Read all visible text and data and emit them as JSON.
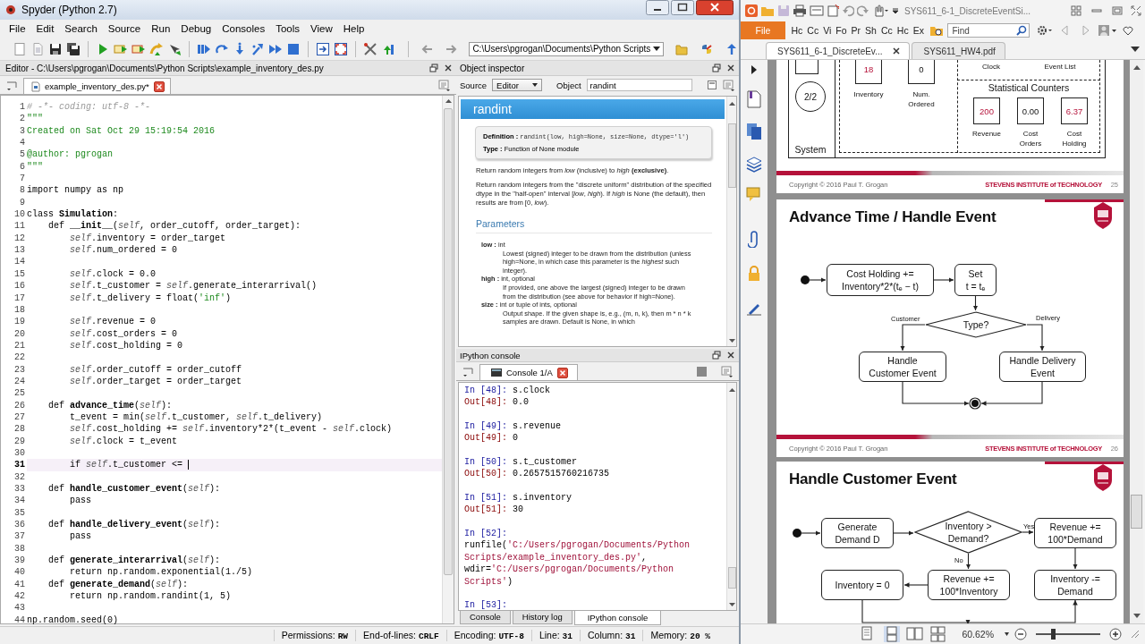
{
  "spyder": {
    "title": "Spyder (Python 2.7)",
    "menu": [
      "File",
      "Edit",
      "Search",
      "Source",
      "Run",
      "Debug",
      "Consoles",
      "Tools",
      "View",
      "Help"
    ],
    "path": "C:\\Users\\pgrogan\\Documents\\Python Scripts",
    "editor": {
      "header": "Editor - C:\\Users\\pgrogan\\Documents\\Python Scripts\\example_inventory_des.py",
      "tabs": [
        {
          "label": "example_inventory_des.py*",
          "selected": true
        }
      ],
      "lines": [
        {
          "number": "1",
          "current": false,
          "segments": [
            {
              "kind": "comment",
              "text": "# -*- coding: utf-8 -*-"
            }
          ]
        },
        {
          "number": "2",
          "current": false,
          "segments": [
            {
              "kind": "string",
              "text": "\"\"\""
            }
          ]
        },
        {
          "number": "3",
          "current": false,
          "segments": [
            {
              "kind": "string",
              "text": "Created on Sat Oct 29 15:19:54 2016"
            }
          ]
        },
        {
          "number": "4",
          "current": false
        },
        {
          "number": "5",
          "current": false,
          "segments": [
            {
              "kind": "string",
              "text": "@author: pgrogan"
            }
          ]
        },
        {
          "number": "6",
          "current": false,
          "segments": [
            {
              "kind": "string",
              "text": "\"\"\""
            }
          ]
        },
        {
          "number": "7",
          "current": false
        },
        {
          "number": "8",
          "current": false,
          "segments": [
            {
              "kind": "plain",
              "text": "import numpy as np"
            }
          ]
        },
        {
          "number": "9",
          "current": false
        },
        {
          "number": "10",
          "current": false,
          "segments": [
            {
              "kind": "plain",
              "text": "class "
            },
            {
              "kind": "name",
              "text": "Simulation"
            },
            {
              "kind": "plain",
              "text": ":"
            }
          ]
        },
        {
          "number": "11",
          "current": false,
          "segments": [
            {
              "kind": "plain",
              "text": "    def "
            },
            {
              "kind": "name",
              "text": "__init__"
            },
            {
              "kind": "plain",
              "text": "("
            },
            {
              "kind": "self",
              "text": "self"
            },
            {
              "kind": "plain",
              "text": ", order_cutoff, order_target):"
            }
          ]
        },
        {
          "number": "12",
          "current": false,
          "segments": [
            {
              "kind": "self",
              "text": "        self"
            },
            {
              "kind": "plain",
              "text": ".inventory = order_target"
            }
          ]
        },
        {
          "number": "13",
          "current": false,
          "segments": [
            {
              "kind": "self",
              "text": "        self"
            },
            {
              "kind": "plain",
              "text": ".num_ordered = 0"
            }
          ]
        },
        {
          "number": "14",
          "current": false
        },
        {
          "number": "15",
          "current": false,
          "segments": [
            {
              "kind": "self",
              "text": "        self"
            },
            {
              "kind": "plain",
              "text": ".clock = 0.0"
            }
          ]
        },
        {
          "number": "16",
          "current": false,
          "segments": [
            {
              "kind": "self",
              "text": "        self"
            },
            {
              "kind": "plain",
              "text": ".t_customer = "
            },
            {
              "kind": "self",
              "text": "self"
            },
            {
              "kind": "plain",
              "text": ".generate_interarrival()"
            }
          ]
        },
        {
          "number": "17",
          "current": false,
          "segments": [
            {
              "kind": "self",
              "text": "        self"
            },
            {
              "kind": "plain",
              "text": ".t_delivery = float("
            },
            {
              "kind": "string",
              "text": "'inf'"
            },
            {
              "kind": "plain",
              "text": ")"
            }
          ]
        },
        {
          "number": "18",
          "current": false
        },
        {
          "number": "19",
          "current": false,
          "segments": [
            {
              "kind": "self",
              "text": "        self"
            },
            {
              "kind": "plain",
              "text": ".revenue = 0"
            }
          ]
        },
        {
          "number": "20",
          "current": false,
          "segments": [
            {
              "kind": "self",
              "text": "        self"
            },
            {
              "kind": "plain",
              "text": ".cost_orders = 0"
            }
          ]
        },
        {
          "number": "21",
          "current": false,
          "segments": [
            {
              "kind": "self",
              "text": "        self"
            },
            {
              "kind": "plain",
              "text": ".cost_holding = 0"
            }
          ]
        },
        {
          "number": "22",
          "current": false
        },
        {
          "number": "23",
          "current": false,
          "segments": [
            {
              "kind": "self",
              "text": "        self"
            },
            {
              "kind": "plain",
              "text": ".order_cutoff = order_cutoff"
            }
          ]
        },
        {
          "number": "24",
          "current": false,
          "segments": [
            {
              "kind": "self",
              "text": "        self"
            },
            {
              "kind": "plain",
              "text": ".order_target = order_target"
            }
          ]
        },
        {
          "number": "25",
          "current": false
        },
        {
          "number": "26",
          "current": false,
          "segments": [
            {
              "kind": "plain",
              "text": "    def "
            },
            {
              "kind": "name",
              "text": "advance_time"
            },
            {
              "kind": "plain",
              "text": "("
            },
            {
              "kind": "self",
              "text": "self"
            },
            {
              "kind": "plain",
              "text": "):"
            }
          ]
        },
        {
          "number": "27",
          "current": false,
          "segments": [
            {
              "kind": "plain",
              "text": "        t_event = min("
            },
            {
              "kind": "self",
              "text": "self"
            },
            {
              "kind": "plain",
              "text": ".t_customer, "
            },
            {
              "kind": "self",
              "text": "self"
            },
            {
              "kind": "plain",
              "text": ".t_delivery)"
            }
          ]
        },
        {
          "number": "28",
          "current": false,
          "segments": [
            {
              "kind": "self",
              "text": "        self"
            },
            {
              "kind": "plain",
              "text": ".cost_holding += "
            },
            {
              "kind": "self",
              "text": "self"
            },
            {
              "kind": "plain",
              "text": ".inventory*2*(t_event - "
            },
            {
              "kind": "self",
              "text": "self"
            },
            {
              "kind": "plain",
              "text": ".clock)"
            }
          ]
        },
        {
          "number": "29",
          "current": false,
          "segments": [
            {
              "kind": "self",
              "text": "        self"
            },
            {
              "kind": "plain",
              "text": ".clock = t_event"
            }
          ]
        },
        {
          "number": "30",
          "current": false
        },
        {
          "number": "31",
          "current": true,
          "segments": [
            {
              "kind": "plain",
              "text": "        if "
            },
            {
              "kind": "self",
              "text": "self"
            },
            {
              "kind": "plain",
              "text": ".t_customer <= "
            }
          ]
        },
        {
          "number": "32",
          "current": false
        },
        {
          "number": "33",
          "current": false,
          "segments": [
            {
              "kind": "plain",
              "text": "    def "
            },
            {
              "kind": "name",
              "text": "handle_customer_event"
            },
            {
              "kind": "plain",
              "text": "("
            },
            {
              "kind": "self",
              "text": "self"
            },
            {
              "kind": "plain",
              "text": "):"
            }
          ]
        },
        {
          "number": "34",
          "current": false,
          "segments": [
            {
              "kind": "plain",
              "text": "        pass"
            }
          ]
        },
        {
          "number": "35",
          "current": false
        },
        {
          "number": "36",
          "current": false,
          "segments": [
            {
              "kind": "plain",
              "text": "    def "
            },
            {
              "kind": "name",
              "text": "handle_delivery_event"
            },
            {
              "kind": "plain",
              "text": "("
            },
            {
              "kind": "self",
              "text": "self"
            },
            {
              "kind": "plain",
              "text": "):"
            }
          ]
        },
        {
          "number": "37",
          "current": false,
          "segments": [
            {
              "kind": "plain",
              "text": "        pass"
            }
          ]
        },
        {
          "number": "38",
          "current": false
        },
        {
          "number": "39",
          "current": false,
          "segments": [
            {
              "kind": "plain",
              "text": "    def "
            },
            {
              "kind": "name",
              "text": "generate_interarrival"
            },
            {
              "kind": "plain",
              "text": "("
            },
            {
              "kind": "self",
              "text": "self"
            },
            {
              "kind": "plain",
              "text": "):"
            }
          ]
        },
        {
          "number": "40",
          "current": false,
          "segments": [
            {
              "kind": "plain",
              "text": "        return np.random.exponential(1./5)"
            }
          ]
        },
        {
          "number": "41",
          "current": false,
          "segments": [
            {
              "kind": "plain",
              "text": "    def "
            },
            {
              "kind": "name",
              "text": "generate_demand"
            },
            {
              "kind": "plain",
              "text": "("
            },
            {
              "kind": "self",
              "text": "self"
            },
            {
              "kind": "plain",
              "text": "):"
            }
          ]
        },
        {
          "number": "42",
          "current": false,
          "segments": [
            {
              "kind": "plain",
              "text": "        return np.random.randint(1, 5)"
            }
          ]
        },
        {
          "number": "43",
          "current": false
        },
        {
          "number": "44",
          "current": false,
          "segments": [
            {
              "kind": "plain",
              "text": "np.random.seed(0)"
            }
          ]
        }
      ]
    },
    "inspector": {
      "header": "Object inspector",
      "source_label": "Source",
      "source": "Editor",
      "object_label": "Object",
      "object": "randint",
      "title": "randint",
      "definition_label": "Definition :",
      "definition": "randint(low, high=None, size=None, dtype='l')",
      "type_label": "Type :",
      "type": "Function of None module",
      "paragraphs": [
        "Return random integers from *low* (inclusive) to *high* **(exclusive)**.",
        "Return random integers from the \"discrete uniform\" distribution of the specified dtype in the \"half-open\" interval [*low*, *high*). If *high* is None (the default), then results are from [0, *low*)."
      ],
      "section": "Parameters",
      "params": [
        {
          "name": "low :",
          "type": "int",
          "description": "Lowest (signed) integer to be drawn from the distribution (unless high=None, in which case this parameter is the *highest* such integer)."
        },
        {
          "name": "high :",
          "type": "int, optional",
          "description": "If provided, one above the largest (signed) integer to be drawn from the distribution (see above for behavior if high=None)."
        },
        {
          "name": "size :",
          "type": "int or tuple of ints, optional",
          "description": "Output shape. If the given shape is, e.g., (m, n, k), then m * n * k samples are drawn. Default is None, in which"
        }
      ]
    },
    "console": {
      "header": "IPython console",
      "tabs": [
        {
          "label": "Console 1/A",
          "selected": true
        }
      ],
      "lines": [
        {
          "segments": [
            {
              "kind": "in",
              "text": "In [48]: "
            },
            {
              "kind": "plain",
              "text": "s.clock"
            }
          ]
        },
        {
          "segments": [
            {
              "kind": "out",
              "text": "Out[48]: "
            },
            {
              "kind": "plain",
              "text": "0.0"
            }
          ]
        },
        {
          "kind": "blank"
        },
        {
          "segments": [
            {
              "kind": "in",
              "text": "In [49]: "
            },
            {
              "kind": "plain",
              "text": "s.revenue"
            }
          ]
        },
        {
          "segments": [
            {
              "kind": "out",
              "text": "Out[49]: "
            },
            {
              "kind": "plain",
              "text": "0"
            }
          ]
        },
        {
          "kind": "blank"
        },
        {
          "segments": [
            {
              "kind": "in",
              "text": "In [50]: "
            },
            {
              "kind": "plain",
              "text": "s.t_customer"
            }
          ]
        },
        {
          "segments": [
            {
              "kind": "out",
              "text": "Out[50]: "
            },
            {
              "kind": "plain",
              "text": "0.2657515760216735"
            }
          ]
        },
        {
          "kind": "blank"
        },
        {
          "segments": [
            {
              "kind": "in",
              "text": "In [51]: "
            },
            {
              "kind": "plain",
              "text": "s.inventory"
            }
          ]
        },
        {
          "segments": [
            {
              "kind": "out",
              "text": "Out[51]: "
            },
            {
              "kind": "plain",
              "text": "30"
            }
          ]
        },
        {
          "kind": "blank"
        },
        {
          "segments": [
            {
              "kind": "in",
              "text": "In [52]:"
            }
          ]
        },
        {
          "segments": [
            {
              "kind": "plain",
              "text": "runfile("
            },
            {
              "kind": "string",
              "text": "'C:/Users/pgrogan/Documents/Python"
            }
          ]
        },
        {
          "segments": [
            {
              "kind": "string",
              "text": "Scripts/example_inventory_des.py'"
            },
            {
              "kind": "plain",
              "text": ","
            }
          ]
        },
        {
          "segments": [
            {
              "kind": "plain",
              "text": "wdir="
            },
            {
              "kind": "string",
              "text": "'C:/Users/pgrogan/Documents/Python"
            }
          ]
        },
        {
          "segments": [
            {
              "kind": "string",
              "text": "Scripts'"
            },
            {
              "kind": "plain",
              "text": ")"
            }
          ]
        },
        {
          "kind": "blank"
        },
        {
          "segments": [
            {
              "kind": "in",
              "text": "In [53]:"
            }
          ]
        }
      ],
      "bottom_tabs": [
        {
          "label": "Console",
          "selected": false
        },
        {
          "label": "History log",
          "selected": false
        },
        {
          "label": "IPython console",
          "selected": true
        }
      ]
    },
    "status_bar": [
      {
        "label": "Permissions:",
        "value": "RW"
      },
      {
        "label": "End-of-lines:",
        "value": "CRLF"
      },
      {
        "label": "Encoding:",
        "value": "UTF-8"
      },
      {
        "label": "Line:",
        "value": "31"
      },
      {
        "label": "Column:",
        "value": "31"
      },
      {
        "label": "Memory:",
        "value": "20 %"
      }
    ]
  },
  "reader": {
    "title": "SYS611_6-1_DiscreteEventSi...",
    "file_button": "File",
    "ribbon_tabs": [
      "Hc",
      "Cc",
      "Vi",
      "Fo",
      "Pr",
      "Sh",
      "Cc",
      "Hc",
      "Ex"
    ],
    "find_placeholder": "Find",
    "tabs": [
      {
        "label": "SYS611_6-1_DiscreteEv...",
        "selected": true
      },
      {
        "label": "SYS611_HW4.pdf",
        "selected": false
      }
    ],
    "pages": [
      {
        "kind": "system-state",
        "fraction": "2/2",
        "system_label": "System",
        "clock_label": "Clock",
        "event_list_label": "Event List",
        "state_variables": [
          {
            "value": "18",
            "label": "Inventory",
            "changed": true
          },
          {
            "value": "0",
            "label": "Num. Ordered",
            "changed": false
          }
        ],
        "counters_title": "Statistical Counters",
        "counters": [
          {
            "value": "200",
            "label": "Revenue",
            "changed": true
          },
          {
            "value": "0.00",
            "label": "Cost Orders",
            "changed": false
          },
          {
            "value": "6.37",
            "label": "Cost Holding",
            "changed": true
          }
        ],
        "footer": {
          "copyright": "Copyright © 2016 Paul T. Grogan",
          "brand": "STEVENS INSTITUTE of TECHNOLOGY",
          "page": "25"
        }
      },
      {
        "kind": "advance-flow",
        "title": "Advance Time / Handle Event",
        "nodes": [
          [
            "Cost Holding +=",
            "Inventory*2*(tₑ − t)"
          ],
          [
            "Set",
            "t = tₑ"
          ],
          [
            "Type?"
          ],
          [
            "Handle",
            "Customer Event"
          ],
          [
            "Handle Delivery",
            "Event"
          ]
        ],
        "branches": [
          "Customer",
          "Delivery"
        ],
        "footer": {
          "copyright": "Copyright © 2016 Paul T. Grogan",
          "brand": "STEVENS INSTITUTE of TECHNOLOGY",
          "page": "26"
        }
      },
      {
        "kind": "customer-flow",
        "title": "Handle Customer Event",
        "nodes": [
          [
            "Generate",
            "Demand D"
          ],
          [
            "Inventory >",
            "Demand?"
          ],
          [
            "Revenue +=",
            "100*Demand"
          ],
          [
            "Inventory = 0"
          ],
          [
            "Revenue +=",
            "100*Inventory"
          ],
          [
            "Inventory -=",
            "Demand"
          ]
        ],
        "branches": [
          "Yes",
          "No"
        ]
      }
    ],
    "zoom": {
      "reading": "60.62%",
      "level": 0.26
    }
  }
}
